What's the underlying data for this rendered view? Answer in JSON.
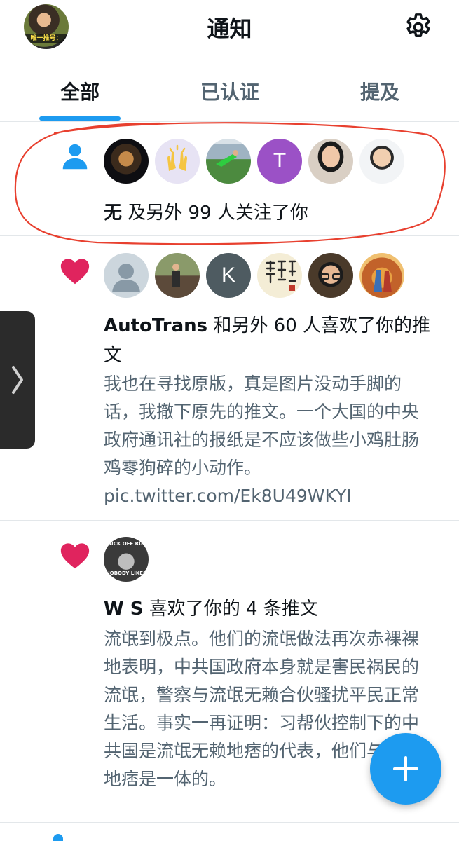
{
  "header": {
    "title": "通知",
    "avatar_caption": "唯一推号：",
    "settings_icon": "gear-icon"
  },
  "tabs": [
    {
      "label": "全部",
      "active": true
    },
    {
      "label": "已认证",
      "active": false
    },
    {
      "label": "提及",
      "active": false
    }
  ],
  "notifications": [
    {
      "type": "follow",
      "icon": "person-icon",
      "avatars": [
        "pavilion-photo",
        "raised-hands-emoji",
        "soccer-goalkeeper",
        "T",
        "woman-photo",
        "man-photo"
      ],
      "actor": "无",
      "text": " 及另外 99 人关注了你"
    },
    {
      "type": "like",
      "icon": "heart-icon",
      "avatars": [
        "default-avatar",
        "man-outdoors",
        "K",
        "calligraphy",
        "man-glasses",
        "painting"
      ],
      "actor": "AutoTrans",
      "text": " 和另外 60 人喜欢了你的推文",
      "body": "我也在寻找原版，真是图片没动手脚的话，我撤下原先的推文。一个大国的中央政府通讯社的报纸是不应该做些小鸡肚肠鸡零狗碎的小动作。",
      "link": "pic.twitter.com/Ek8U49WKYI"
    },
    {
      "type": "like",
      "icon": "heart-icon",
      "avatars": [
        "meme-avatar"
      ],
      "avatar_caption_top": "FUCK OFF RUS",
      "avatar_caption_bottom": "NOBODY LIKES",
      "actor": "W S",
      "text": " 喜欢了你的 4 条推文",
      "body": "流氓到极点。他们的流氓做法再次赤裸裸地表明，中共国政府本身就是害民祸民的流氓，警察与流氓无赖合伙骚扰平民正常生活。事实一再证明：习帮伙控制下的中共国是流氓无赖地痞的代表，他们与流氓地痞是一体的。"
    }
  ],
  "colors": {
    "accent": "#1d9bf0",
    "heart": "#e0245e",
    "annotation": "#e8402f",
    "secondary_text": "#536471"
  },
  "fab": {
    "icon": "plus-icon"
  }
}
